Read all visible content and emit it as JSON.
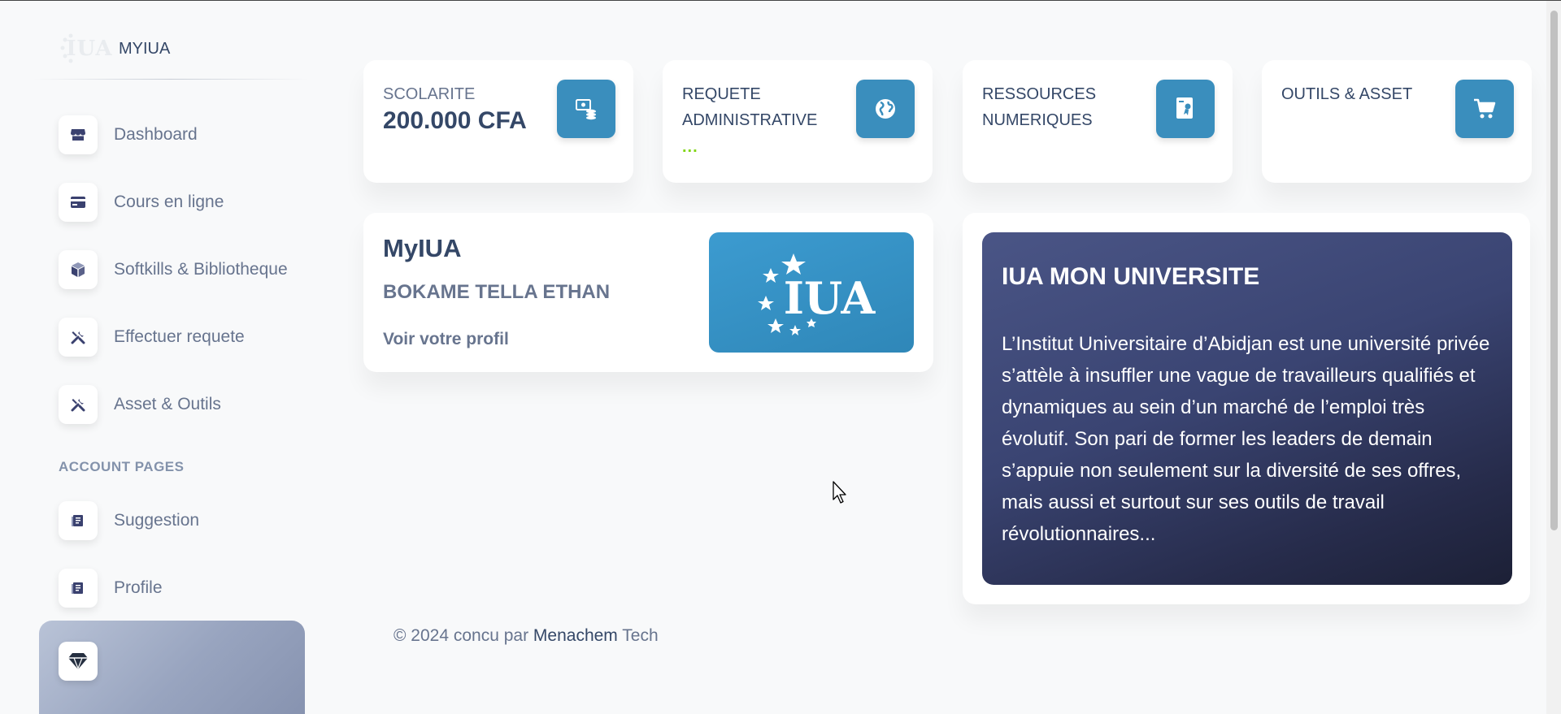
{
  "brand": {
    "logo_text": "IUA",
    "name": "MYIUA"
  },
  "sidebar": {
    "items": [
      {
        "label": "Dashboard",
        "icon": "shop-icon"
      },
      {
        "label": "Cours en ligne",
        "icon": "credit-card-icon"
      },
      {
        "label": "Softkills & Bibliotheque",
        "icon": "box-icon"
      },
      {
        "label": "Effectuer requete",
        "icon": "tools-icon"
      },
      {
        "label": "Asset & Outils",
        "icon": "tools-icon"
      }
    ],
    "account_heading": "ACCOUNT PAGES",
    "account_items": [
      {
        "label": "Suggestion",
        "icon": "document-icon"
      },
      {
        "label": "Profile",
        "icon": "document-icon"
      }
    ],
    "help_icon": "diamond-icon"
  },
  "stats": [
    {
      "title": "SCOLARITE",
      "value": "200.000 CFA",
      "icon": "money-coins-icon"
    },
    {
      "title": "REQUETE ADMINISTRATIVE",
      "value": "...",
      "icon": "world-icon"
    },
    {
      "title": "RESSOURCES NUMERIQUES",
      "value": "",
      "icon": "paper-diploma-icon"
    },
    {
      "title": "OUTILS & ASSET",
      "value": "",
      "icon": "cart-icon"
    }
  ],
  "profile": {
    "app_name": "MyIUA",
    "student_name": "BOKAME TELLA ETHAN",
    "link": "Voir votre profil",
    "image_text": "IUA"
  },
  "university": {
    "title": "IUA MON UNIVERSITE",
    "text": "L’Institut Universitaire d’Abidjan est une université privée s’attèle à insuffler une vague de travailleurs qualifiés et dynamiques au sein d’un marché de l’emploi très évolutif. Son pari de former les leaders de demain s’appuie non seulement sur la diversité de ses offres, mais aussi et surtout sur ses outils de travail révolutionnaires..."
  },
  "footer": {
    "prefix": "© 2024 concu par ",
    "link": "Menachem",
    "suffix": " Tech"
  },
  "colors": {
    "accent": "#3a8ebd",
    "text_dark": "#344767",
    "text_muted": "#67748e",
    "success": "#82d616"
  }
}
